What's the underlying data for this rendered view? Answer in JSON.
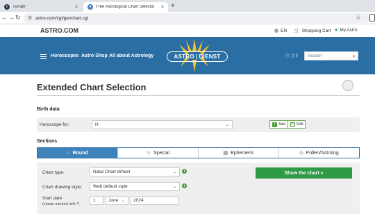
{
  "browser": {
    "tabs": [
      {
        "title": "Tumblr",
        "favicon_color": "#2b3a4d",
        "active": false
      },
      {
        "title": "Free Astrological Chart Selectio",
        "favicon_color": "#4a7fc0",
        "active": true
      }
    ],
    "new_tab": "+",
    "url": "astro.com/cgi/genchart.cgi"
  },
  "site": {
    "logo": "ASTRO.COM",
    "language": "EN",
    "cart": "Shopping Cart",
    "account": "My Astro"
  },
  "nav": {
    "links": [
      "Horoscopes",
      "Astro Shop",
      "All about Astrology"
    ],
    "brand_left": "ASTRO",
    "brand_right": "DIENST",
    "symbols": "☉☽☿",
    "search_placeholder": "Search"
  },
  "page": {
    "title": "Extended Chart Selection",
    "birth_data": {
      "heading": "Birth data",
      "horoscope_for_label": "Horoscope for:",
      "horoscope_for_value": "H",
      "add_label": "Add",
      "edit_label": "Edit"
    },
    "sections": {
      "heading": "Sections",
      "tabs": [
        {
          "label": "Round",
          "icon": "circle-icon",
          "glyph": "○",
          "active": true
        },
        {
          "label": "Special",
          "icon": "star-icon",
          "glyph": "☆",
          "active": false
        },
        {
          "label": "Ephemeris",
          "icon": "document-icon",
          "glyph": "▤",
          "active": false
        },
        {
          "label": "Pullen/Astrolog",
          "icon": "diamond-icon",
          "glyph": "◇",
          "active": false
        }
      ]
    },
    "options": {
      "chart_type_label": "Chart type:",
      "chart_type_value": "Natal Chart Wheel",
      "drawing_style_label": "Chart drawing style:",
      "drawing_style_value": "Web default style",
      "start_date_label": "Start date",
      "start_date_note": "(charts marked with *)",
      "day": "1",
      "month": "June",
      "year": "2024",
      "show_button": "Show the chart »"
    }
  },
  "colors": {
    "nav_band": "#2b6ea3",
    "active_tab": "#3f83bd",
    "show_button": "#2f9a45",
    "info_icon": "#4c9a3a"
  }
}
